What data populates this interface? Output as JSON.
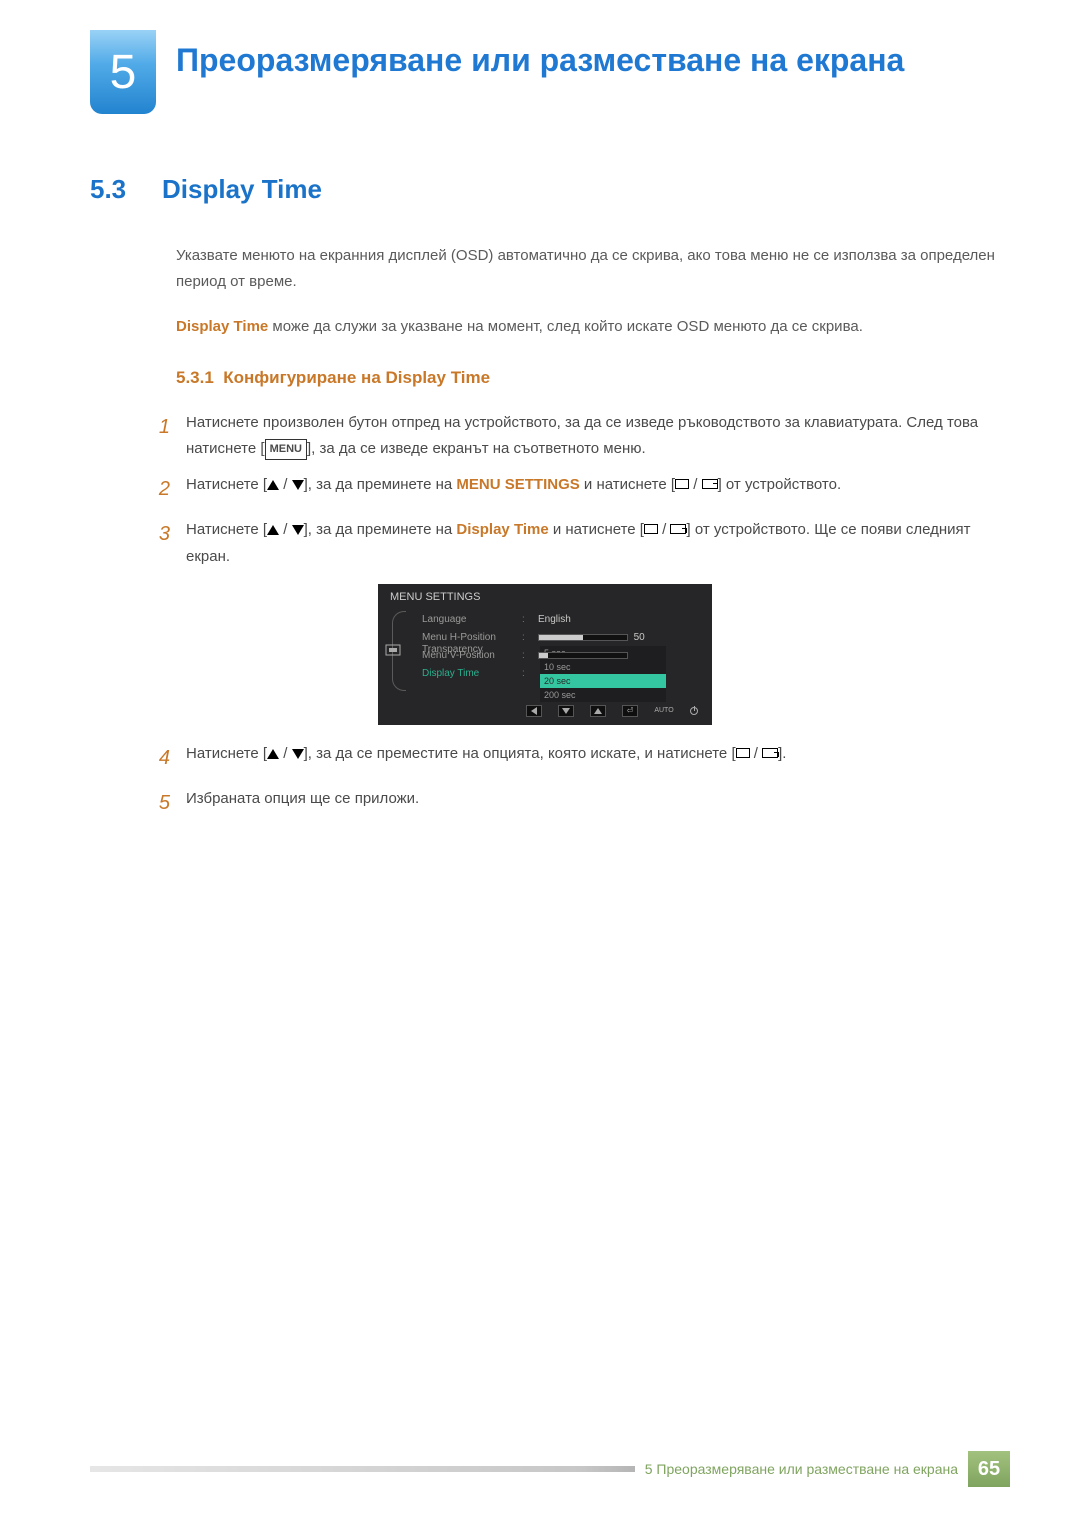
{
  "chapter": {
    "number": "5",
    "title": "Преоразмеряване или разместване на екрана"
  },
  "section": {
    "number": "5.3",
    "title": "Display Time"
  },
  "intro1": "Указвате менюто на екранния дисплей (OSD) автоматично да се скрива, ако това меню не се използва за определен период от време.",
  "intro2_strong": "Display Time",
  "intro2_rest": " може да служи за указване на момент, след който искате OSD менюто да се скрива.",
  "sub": {
    "number": "5.3.1",
    "title": "Конфигуриране на Display Time"
  },
  "steps": {
    "s1a": "Натиснете произволен бутон отпред на устройството, за да се изведе ръководството за клавиатурата. След това натиснете [",
    "s1_menu": "MENU",
    "s1b": "], за да се изведе екранът на съответното меню.",
    "s2a": "Натиснете [",
    "s2b": "], за да преминете на ",
    "s2_menu_settings": "MENU SETTINGS",
    "s2c": " и натиснете [",
    "s2d": "] от устройството.",
    "s3a": "Натиснете [",
    "s3b": "], за да преминете на ",
    "s3_display_time": "Display Time",
    "s3c": " и натиснете [",
    "s3d": "] от устройството. Ще се появи следният екран.",
    "s4a": "Натиснете [",
    "s4b": "], за да се преместите на опцията, която искате, и натиснете [",
    "s4c": "].",
    "s5": "Избраната опция ще се приложи."
  },
  "osd": {
    "title": "MENU SETTINGS",
    "rows": {
      "language": {
        "label": "Language",
        "value": "English"
      },
      "hpos": {
        "label": "Menu H-Position",
        "value": "50",
        "pct": 50
      },
      "vpos": {
        "label": "Menu V-Position",
        "value": "10",
        "pct": 10
      },
      "dtime": {
        "label": "Display Time"
      },
      "trans": {
        "label": "Transparency"
      }
    },
    "options": [
      "5 sec",
      "10 sec",
      "20 sec",
      "200 sec"
    ],
    "selected_index": 2,
    "auto": "AUTO"
  },
  "footer": {
    "text": "5 Преоразмеряване или разместване на екрана",
    "page": "65"
  }
}
